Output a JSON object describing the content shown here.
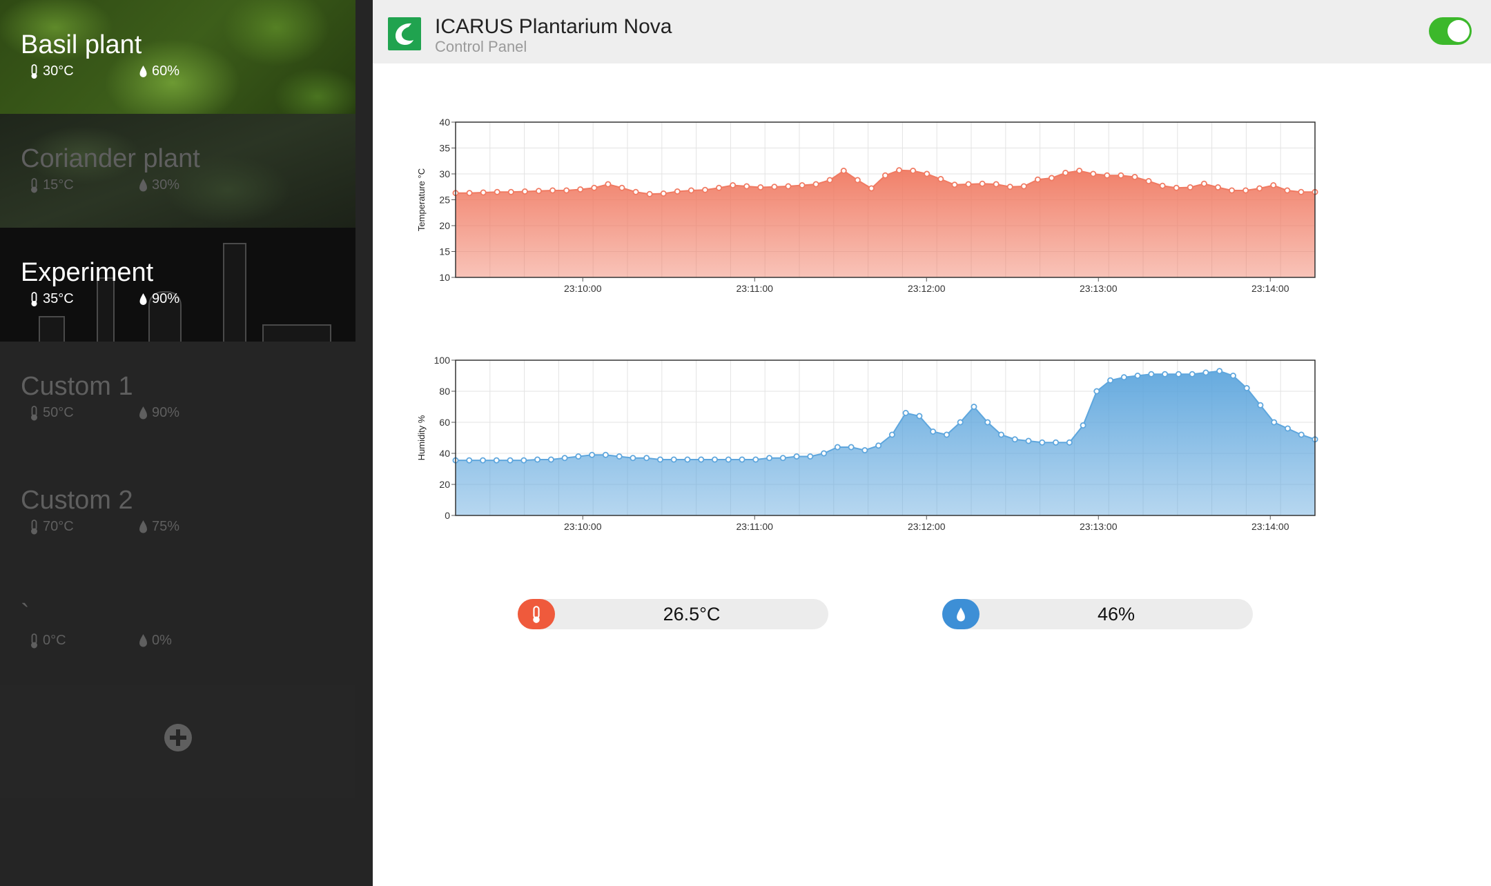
{
  "header": {
    "title": "ICARUS Plantarium Nova",
    "subtitle": "Control Panel",
    "logo_icon": "leaf-icon",
    "power_on": true,
    "accent": "#20a34f"
  },
  "sidebar": {
    "presets": [
      {
        "name": "Basil plant",
        "temp": "30°C",
        "humidity": "60%"
      },
      {
        "name": "Coriander plant",
        "temp": "15°C",
        "humidity": "30%"
      },
      {
        "name": "Experiment",
        "temp": "35°C",
        "humidity": "90%"
      },
      {
        "name": "Custom 1",
        "temp": "50°C",
        "humidity": "90%"
      },
      {
        "name": "Custom 2",
        "temp": "70°C",
        "humidity": "75%"
      },
      {
        "name": "`",
        "temp": "0°C",
        "humidity": "0%"
      }
    ],
    "add_icon": "plus-circle-icon"
  },
  "chart_data": [
    {
      "type": "area",
      "ylabel": "Temperature °C",
      "ylim": [
        10,
        40
      ],
      "yticks": [
        10,
        15,
        20,
        25,
        30,
        35,
        40
      ],
      "xtick_labels": [
        "23:10:00",
        "23:11:00",
        "23:12:00",
        "23:13:00",
        "23:14:00"
      ],
      "grid": true,
      "color": "#f07a62",
      "values": [
        26.3,
        26.3,
        26.4,
        26.5,
        26.5,
        26.6,
        26.7,
        26.8,
        26.8,
        27.0,
        27.3,
        28.0,
        27.3,
        26.5,
        26.1,
        26.2,
        26.6,
        26.8,
        26.9,
        27.3,
        27.8,
        27.6,
        27.4,
        27.5,
        27.6,
        27.8,
        28.0,
        28.8,
        30.6,
        28.8,
        27.2,
        29.7,
        30.7,
        30.6,
        30.0,
        29.0,
        27.9,
        28.0,
        28.1,
        28.0,
        27.5,
        27.6,
        28.9,
        29.2,
        30.2,
        30.6,
        30.0,
        29.7,
        29.7,
        29.4,
        28.6,
        27.7,
        27.3,
        27.4,
        28.1,
        27.4,
        26.8,
        26.8,
        27.2,
        27.8,
        26.8,
        26.5,
        26.5
      ]
    },
    {
      "type": "area",
      "ylabel": "Humidity %",
      "ylim": [
        0,
        100
      ],
      "yticks": [
        0,
        20,
        40,
        60,
        80,
        100
      ],
      "xtick_labels": [
        "23:10:00",
        "23:11:00",
        "23:12:00",
        "23:13:00",
        "23:14:00"
      ],
      "grid": true,
      "color": "#5ea6dd",
      "values": [
        35.5,
        35.5,
        35.5,
        35.5,
        35.5,
        35.5,
        36,
        36,
        37,
        38,
        39,
        39,
        38,
        37,
        37,
        36,
        36,
        36,
        36,
        36,
        36,
        36,
        36,
        37,
        37,
        38,
        38,
        40,
        44,
        44,
        42,
        45,
        52,
        66,
        64,
        54,
        52,
        60,
        70,
        60,
        52,
        49,
        48,
        47,
        47,
        47,
        58,
        80,
        87,
        89,
        90,
        91,
        91,
        91,
        91,
        92,
        93,
        90,
        82,
        71,
        60,
        56,
        52,
        49
      ]
    }
  ],
  "readouts": {
    "temperature": {
      "value": "26.5°C",
      "icon": "thermometer-icon",
      "color": "#ef5a3c"
    },
    "humidity": {
      "value": "46%",
      "icon": "droplet-icon",
      "color": "#3d8fd6"
    }
  }
}
